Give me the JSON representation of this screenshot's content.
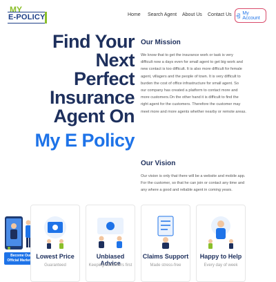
{
  "brand": {
    "logo_top": "MY",
    "logo_bottom": "E-POLICY"
  },
  "nav": {
    "items": [
      "Home",
      "Search Agent",
      "About Us",
      "Contact Us"
    ],
    "account_label": "My Account"
  },
  "hero": {
    "title_lines": [
      "Find Your Next",
      "Perfect",
      "Insurance",
      "Agent On"
    ],
    "title_accent": "My E Policy"
  },
  "mission": {
    "heading": "Our Mission",
    "lines": [
      "We know that to get the insurance work or task is very",
      "difficult now a days even for small agent to get big work and",
      "new contact is too difficult. It is also more difficult for female",
      "agent, villagers and the people of town. It is very difficult to",
      "burden the cost of office infrastructure for small agent. So",
      "our company has created a platform to contact more and",
      "more customers.On the other hand it is difficult to find the",
      "right agent for the customers. Therefore the customer may",
      "meet more and more agents whether nearby or remote areas."
    ]
  },
  "vision": {
    "heading": "Our Vision",
    "lines": [
      "Our vision is only that there will be a website and mobile app.",
      "For the customer, so that he can join or contact any time and",
      "any where a good and reliable agent in coming years."
    ]
  },
  "promo": {
    "line1": "Become Our",
    "line2": "Official Marketer"
  },
  "features": [
    {
      "title": "Lowest Price",
      "subtitle": "Guaranteed"
    },
    {
      "title": "Unbiased Advice",
      "subtitle": "Keeping customers first"
    },
    {
      "title": "Claims Support",
      "subtitle": "Made stress-free"
    },
    {
      "title": "Happy to Help",
      "subtitle": "Every day of week"
    }
  ],
  "colors": {
    "navy": "#1d2f5c",
    "accent": "#1e73e8",
    "logo_green": "#8bbf2a"
  }
}
